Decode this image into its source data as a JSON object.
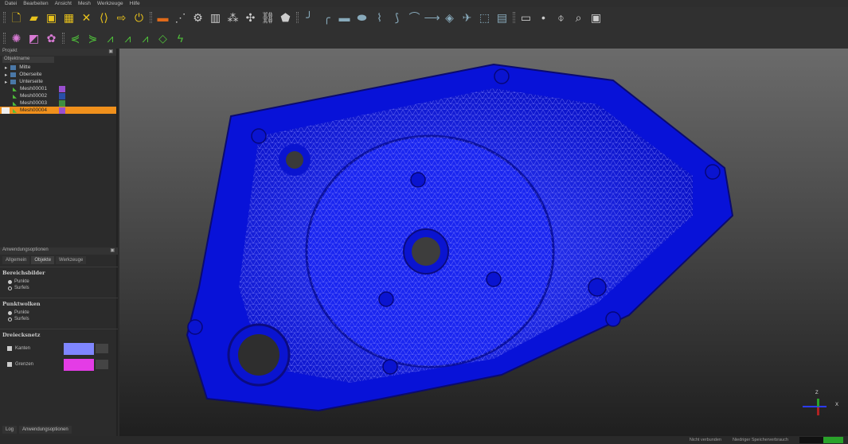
{
  "menu": [
    "Datei",
    "Bearbeiten",
    "Ansicht",
    "Mesh",
    "Werkzeuge",
    "Hilfe"
  ],
  "project_panel": {
    "title": "Projekt",
    "column": "Objektname",
    "items": [
      {
        "label": "Mitte",
        "type": "group"
      },
      {
        "label": "Oberseite",
        "type": "group"
      },
      {
        "label": "Unterseite",
        "type": "group"
      },
      {
        "label": "Mesh00001",
        "color": "#9a4fcf"
      },
      {
        "label": "Mesh00002",
        "color": "#2a4fa8"
      },
      {
        "label": "Mesh00003",
        "color": "#3f8f3f"
      },
      {
        "label": "Mesh00004",
        "color": "#9a4fcf",
        "selected": true
      }
    ]
  },
  "options_panel": {
    "title": "Anwendungsoptionen",
    "tabs": [
      "Allgemein",
      "Objekte",
      "Werkzeuge"
    ],
    "active_tab": "Objekte",
    "sections": [
      {
        "title": "Bereichsbilder",
        "options": [
          "Punkte",
          "Surfels"
        ],
        "selected": "Punkte"
      },
      {
        "title": "Punktwolken",
        "options": [
          "Punkte",
          "Surfels"
        ],
        "selected": "Punkte"
      },
      {
        "title": "Dreiecksnetz",
        "checks": [
          {
            "label": "Kanten",
            "checked": true,
            "color": "#7f86ff"
          },
          {
            "label": "Grenzen",
            "checked": true,
            "color": "#e43ce6"
          }
        ]
      }
    ]
  },
  "bottom_tabs": [
    "Log",
    "Anwendungsoptionen"
  ],
  "axes": {
    "z": "Z",
    "x": "X"
  },
  "status": {
    "connection": "Nicht verbunden",
    "memory": "Niedriger Speicherverbrauch",
    "memory_level": 0.45
  }
}
